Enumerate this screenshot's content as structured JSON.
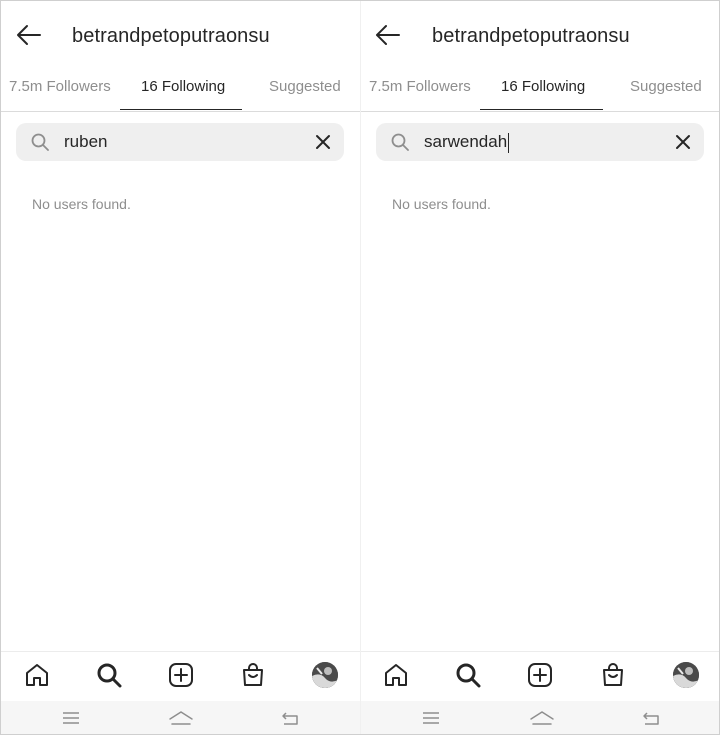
{
  "panels": [
    {
      "header": {
        "title": "betrandpetoputraonsu"
      },
      "tabs": [
        {
          "label": "7.5m Followers",
          "active": false
        },
        {
          "label": "16 Following",
          "active": true
        },
        {
          "label": "Suggested",
          "active": false
        }
      ],
      "search": {
        "value": "ruben"
      },
      "empty_message": "No users found."
    },
    {
      "header": {
        "title": "betrandpetoputraonsu"
      },
      "tabs": [
        {
          "label": "7.5m Followers",
          "active": false
        },
        {
          "label": "16 Following",
          "active": true
        },
        {
          "label": "Suggested",
          "active": false
        }
      ],
      "search": {
        "value": "sarwendah"
      },
      "empty_message": "No users found."
    }
  ],
  "bottom_nav": [
    "home-icon",
    "search-icon",
    "create-icon",
    "shop-icon",
    "profile-avatar"
  ],
  "system_nav": [
    "menu-icon",
    "home-icon",
    "back-icon"
  ],
  "colors": {
    "text": "#262626",
    "muted": "#8e8e8e",
    "search_bg": "#efefef",
    "divider": "#dbdbdb"
  }
}
